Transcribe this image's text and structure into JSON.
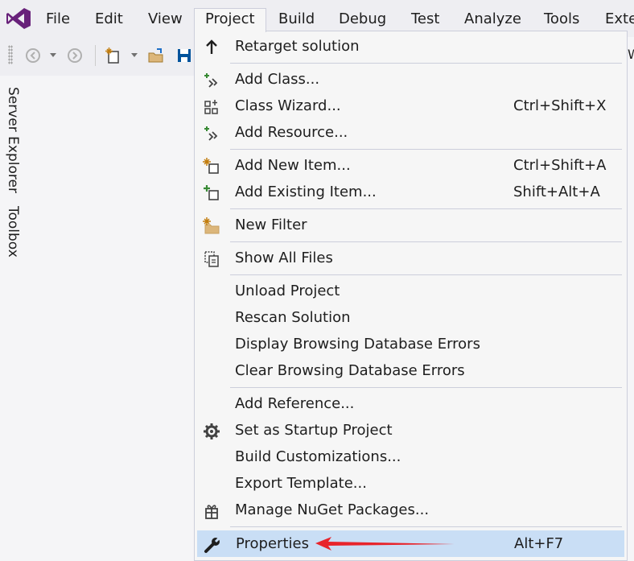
{
  "menubar": {
    "items": [
      "File",
      "Edit",
      "View",
      "Project",
      "Build",
      "Debug",
      "Test",
      "Analyze",
      "Tools",
      "Exte"
    ]
  },
  "toolbar": {
    "right_edge_text": "W"
  },
  "side_panel": {
    "tabs": [
      "Server Explorer",
      "Toolbox"
    ]
  },
  "dropdown": {
    "items": [
      {
        "label": "Retarget solution",
        "shortcut": "",
        "icon": "up-arrow-icon"
      },
      {
        "label": "Add Class...",
        "shortcut": "",
        "icon": "add-class-icon"
      },
      {
        "label": "Class Wizard...",
        "shortcut": "Ctrl+Shift+X",
        "icon": "class-wizard-icon"
      },
      {
        "label": "Add Resource...",
        "shortcut": "",
        "icon": "add-resource-icon"
      },
      {
        "label": "Add New Item...",
        "shortcut": "Ctrl+Shift+A",
        "icon": "add-new-item-icon"
      },
      {
        "label": "Add Existing Item...",
        "shortcut": "Shift+Alt+A",
        "icon": "add-existing-item-icon"
      },
      {
        "label": "New Filter",
        "shortcut": "",
        "icon": "new-filter-icon"
      },
      {
        "label": "Show All Files",
        "shortcut": "",
        "icon": "show-all-files-icon"
      },
      {
        "label": "Unload Project",
        "shortcut": "",
        "icon": ""
      },
      {
        "label": "Rescan Solution",
        "shortcut": "",
        "icon": ""
      },
      {
        "label": "Display Browsing Database Errors",
        "shortcut": "",
        "icon": ""
      },
      {
        "label": "Clear Browsing Database Errors",
        "shortcut": "",
        "icon": ""
      },
      {
        "label": "Add Reference...",
        "shortcut": "",
        "icon": ""
      },
      {
        "label": "Set as Startup Project",
        "shortcut": "",
        "icon": "gear-icon"
      },
      {
        "label": "Build Customizations...",
        "shortcut": "",
        "icon": ""
      },
      {
        "label": "Export Template...",
        "shortcut": "",
        "icon": ""
      },
      {
        "label": "Manage NuGet Packages...",
        "shortcut": "",
        "icon": "nuget-icon"
      },
      {
        "label": "Properties",
        "shortcut": "Alt+F7",
        "icon": "wrench-icon"
      }
    ]
  },
  "colors": {
    "highlight": "#c9def5",
    "vs_purple": "#68217a",
    "arrow_red": "#e8242b"
  }
}
